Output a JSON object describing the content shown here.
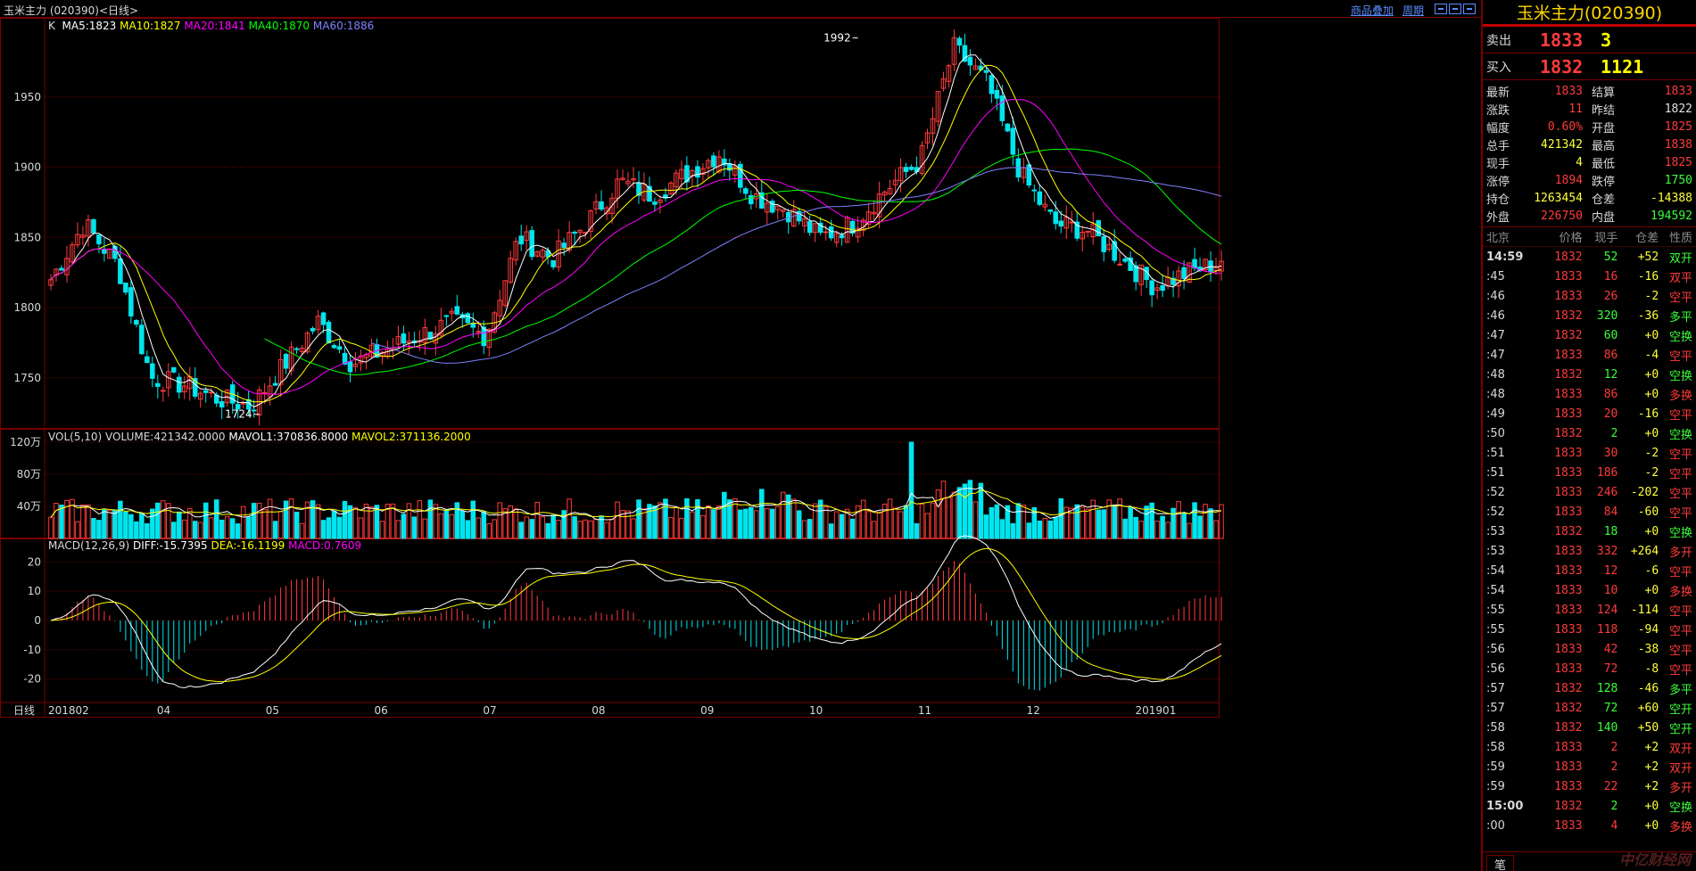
{
  "window": {
    "title": "玉米主力 (020390)<日线>",
    "link_overlay": "商品叠加",
    "link_period": "周期"
  },
  "main_panel": {
    "indicator_prefix": "K",
    "ma5": "MA5:1823",
    "ma10": "MA10:1827",
    "ma20": "MA20:1841",
    "ma40": "MA40:1870",
    "ma60": "MA60:1886",
    "high_label": "1992",
    "low_label": "1724",
    "y_ticks": [
      "1950",
      "1900",
      "1850",
      "1800",
      "1750"
    ]
  },
  "volume_panel": {
    "label_name": "VOL(5,10)",
    "label_volume": "VOLUME:421342.0000",
    "label_mavol1": "MAVOL1:370836.8000",
    "label_mavol2": "MAVOL2:371136.2000",
    "y_ticks": [
      "120万",
      "80万",
      "40万"
    ]
  },
  "macd_panel": {
    "label_name": "MACD(12,26,9)",
    "label_diff": "DIFF:-15.7395",
    "label_dea": "DEA:-16.1199",
    "label_macd": "MACD:0.7609",
    "y_ticks": [
      "20",
      "10",
      "0",
      "-10",
      "-20"
    ]
  },
  "x_axis": {
    "period_label": "日线",
    "labels": [
      "201802",
      "04",
      "05",
      "06",
      "07",
      "08",
      "09",
      "10",
      "11",
      "12",
      "201901"
    ]
  },
  "colors": {
    "up": "#ff3b3b",
    "down": "#00e5ee",
    "ma5": "#ffffff",
    "ma10": "#ffff00",
    "ma20": "#ff00ff",
    "ma40": "#00ff00",
    "ma60": "#8080ff",
    "grid": "#7a0000"
  },
  "quote": {
    "name": "玉米主力(020390)",
    "ask_label": "卖出",
    "ask_price": "1833",
    "ask_vol": "3",
    "bid_label": "买入",
    "bid_price": "1832",
    "bid_vol": "1121",
    "rows": [
      {
        "k": "最新",
        "v": "1833",
        "vc": "red",
        "k2": "结算",
        "v2": "1833",
        "v2c": "red"
      },
      {
        "k": "涨跌",
        "v": "11",
        "vc": "red",
        "k2": "昨结",
        "v2": "1822",
        "v2c": "white"
      },
      {
        "k": "幅度",
        "v": "0.60%",
        "vc": "red",
        "k2": "开盘",
        "v2": "1825",
        "v2c": "red"
      },
      {
        "k": "总手",
        "v": "421342",
        "vc": "yellow",
        "k2": "最高",
        "v2": "1838",
        "v2c": "red"
      },
      {
        "k": "现手",
        "v": "4",
        "vc": "yellow",
        "k2": "最低",
        "v2": "1825",
        "v2c": "red"
      },
      {
        "k": "涨停",
        "v": "1894",
        "vc": "red",
        "k2": "跌停",
        "v2": "1750",
        "v2c": "green"
      },
      {
        "k": "持仓",
        "v": "1263454",
        "vc": "yellow",
        "k2": "仓差",
        "v2": "-14388",
        "v2c": "yellow"
      },
      {
        "k": "外盘",
        "v": "226750",
        "vc": "red",
        "k2": "内盘",
        "v2": "194592",
        "v2c": "green"
      }
    ]
  },
  "ticks": {
    "headers": [
      "北京",
      "价格",
      "现手",
      "仓差",
      "性质"
    ],
    "rows": [
      {
        "t": "14:59",
        "p": "1832",
        "pc": "red",
        "v": "52",
        "vc": "green",
        "o": "+52",
        "oc": "yellow",
        "n": "双开",
        "nc": "green",
        "bold": true
      },
      {
        "t": ":45",
        "p": "1833",
        "pc": "red",
        "v": "16",
        "vc": "red",
        "o": "-16",
        "oc": "yellow",
        "n": "双平",
        "nc": "red"
      },
      {
        "t": ":46",
        "p": "1833",
        "pc": "red",
        "v": "26",
        "vc": "red",
        "o": "-2",
        "oc": "yellow",
        "n": "空平",
        "nc": "red"
      },
      {
        "t": ":46",
        "p": "1832",
        "pc": "red",
        "v": "320",
        "vc": "green",
        "o": "-36",
        "oc": "yellow",
        "n": "多平",
        "nc": "green"
      },
      {
        "t": ":47",
        "p": "1832",
        "pc": "red",
        "v": "60",
        "vc": "green",
        "o": "+0",
        "oc": "yellow",
        "n": "空换",
        "nc": "green"
      },
      {
        "t": ":47",
        "p": "1833",
        "pc": "red",
        "v": "86",
        "vc": "red",
        "o": "-4",
        "oc": "yellow",
        "n": "空平",
        "nc": "red"
      },
      {
        "t": ":48",
        "p": "1832",
        "pc": "red",
        "v": "12",
        "vc": "green",
        "o": "+0",
        "oc": "yellow",
        "n": "空换",
        "nc": "green"
      },
      {
        "t": ":48",
        "p": "1833",
        "pc": "red",
        "v": "86",
        "vc": "red",
        "o": "+0",
        "oc": "yellow",
        "n": "多换",
        "nc": "red"
      },
      {
        "t": ":49",
        "p": "1833",
        "pc": "red",
        "v": "20",
        "vc": "red",
        "o": "-16",
        "oc": "yellow",
        "n": "空平",
        "nc": "red"
      },
      {
        "t": ":50",
        "p": "1832",
        "pc": "red",
        "v": "2",
        "vc": "green",
        "o": "+0",
        "oc": "yellow",
        "n": "空换",
        "nc": "green"
      },
      {
        "t": ":51",
        "p": "1833",
        "pc": "red",
        "v": "30",
        "vc": "red",
        "o": "-2",
        "oc": "yellow",
        "n": "空平",
        "nc": "red"
      },
      {
        "t": ":51",
        "p": "1833",
        "pc": "red",
        "v": "186",
        "vc": "red",
        "o": "-2",
        "oc": "yellow",
        "n": "空平",
        "nc": "red"
      },
      {
        "t": ":52",
        "p": "1833",
        "pc": "red",
        "v": "246",
        "vc": "red",
        "o": "-202",
        "oc": "yellow",
        "n": "空平",
        "nc": "red"
      },
      {
        "t": ":52",
        "p": "1833",
        "pc": "red",
        "v": "84",
        "vc": "red",
        "o": "-60",
        "oc": "yellow",
        "n": "空平",
        "nc": "red"
      },
      {
        "t": ":53",
        "p": "1832",
        "pc": "red",
        "v": "18",
        "vc": "green",
        "o": "+0",
        "oc": "yellow",
        "n": "空换",
        "nc": "green"
      },
      {
        "t": ":53",
        "p": "1833",
        "pc": "red",
        "v": "332",
        "vc": "red",
        "o": "+264",
        "oc": "yellow",
        "n": "多开",
        "nc": "red"
      },
      {
        "t": ":54",
        "p": "1833",
        "pc": "red",
        "v": "12",
        "vc": "red",
        "o": "-6",
        "oc": "yellow",
        "n": "空平",
        "nc": "red"
      },
      {
        "t": ":54",
        "p": "1833",
        "pc": "red",
        "v": "10",
        "vc": "red",
        "o": "+0",
        "oc": "yellow",
        "n": "多换",
        "nc": "red"
      },
      {
        "t": ":55",
        "p": "1833",
        "pc": "red",
        "v": "124",
        "vc": "red",
        "o": "-114",
        "oc": "yellow",
        "n": "空平",
        "nc": "red"
      },
      {
        "t": ":55",
        "p": "1833",
        "pc": "red",
        "v": "118",
        "vc": "red",
        "o": "-94",
        "oc": "yellow",
        "n": "空平",
        "nc": "red"
      },
      {
        "t": ":56",
        "p": "1833",
        "pc": "red",
        "v": "42",
        "vc": "red",
        "o": "-38",
        "oc": "yellow",
        "n": "空平",
        "nc": "red"
      },
      {
        "t": ":56",
        "p": "1833",
        "pc": "red",
        "v": "72",
        "vc": "red",
        "o": "-8",
        "oc": "yellow",
        "n": "空平",
        "nc": "red"
      },
      {
        "t": ":57",
        "p": "1832",
        "pc": "red",
        "v": "128",
        "vc": "green",
        "o": "-46",
        "oc": "yellow",
        "n": "多平",
        "nc": "green"
      },
      {
        "t": ":57",
        "p": "1832",
        "pc": "red",
        "v": "72",
        "vc": "green",
        "o": "+60",
        "oc": "yellow",
        "n": "空开",
        "nc": "green"
      },
      {
        "t": ":58",
        "p": "1832",
        "pc": "red",
        "v": "140",
        "vc": "green",
        "o": "+50",
        "oc": "yellow",
        "n": "空开",
        "nc": "green"
      },
      {
        "t": ":58",
        "p": "1833",
        "pc": "red",
        "v": "2",
        "vc": "red",
        "o": "+2",
        "oc": "yellow",
        "n": "双开",
        "nc": "red"
      },
      {
        "t": ":59",
        "p": "1833",
        "pc": "red",
        "v": "2",
        "vc": "red",
        "o": "+2",
        "oc": "yellow",
        "n": "双开",
        "nc": "red"
      },
      {
        "t": ":59",
        "p": "1833",
        "pc": "red",
        "v": "22",
        "vc": "red",
        "o": "+2",
        "oc": "yellow",
        "n": "多开",
        "nc": "red"
      },
      {
        "t": "15:00",
        "p": "1832",
        "pc": "red",
        "v": "2",
        "vc": "green",
        "o": "+0",
        "oc": "yellow",
        "n": "空换",
        "nc": "green",
        "bold": true
      },
      {
        "t": ":00",
        "p": "1833",
        "pc": "red",
        "v": "4",
        "vc": "red",
        "o": "+0",
        "oc": "yellow",
        "n": "多换",
        "nc": "red"
      }
    ],
    "footer_tab": "笔",
    "watermark": "中亿财经网"
  },
  "chart_data": [
    {
      "type": "candlestick",
      "title": "玉米主力 (020390)<日线>",
      "ylim": [
        1720,
        2000
      ],
      "x": [
        "201802",
        "04",
        "05",
        "06",
        "07",
        "08",
        "09",
        "10",
        "11",
        "12",
        "201901"
      ],
      "annotations": [
        {
          "label": "1992",
          "value": 1992
        },
        {
          "label": "1724",
          "value": 1724
        }
      ],
      "close_anchors": [
        1820,
        1860,
        1830,
        1750,
        1745,
        1735,
        1730,
        1760,
        1790,
        1760,
        1770,
        1780,
        1790,
        1780,
        1850,
        1835,
        1860,
        1890,
        1880,
        1895,
        1910,
        1880,
        1870,
        1850,
        1860,
        1885,
        1905,
        1985,
        1960,
        1895,
        1860,
        1855,
        1835,
        1815,
        1825,
        1833
      ],
      "series": [
        {
          "name": "MA5",
          "values": [
            1823
          ]
        },
        {
          "name": "MA10",
          "values": [
            1827
          ]
        },
        {
          "name": "MA20",
          "values": [
            1841
          ]
        },
        {
          "name": "MA40",
          "values": [
            1870
          ]
        },
        {
          "name": "MA60",
          "values": [
            1886
          ]
        }
      ]
    },
    {
      "type": "bar",
      "title": "VOL(5,10)",
      "ylim": [
        0,
        1300000
      ],
      "series": [
        {
          "name": "VOLUME",
          "values": [
            421342
          ]
        },
        {
          "name": "MAVOL1",
          "values": [
            370836.8
          ]
        },
        {
          "name": "MAVOL2",
          "values": [
            371136.2
          ]
        }
      ]
    },
    {
      "type": "bar",
      "title": "MACD(12,26,9)",
      "ylim": [
        -25,
        25
      ],
      "series": [
        {
          "name": "DIFF",
          "values": [
            -15.7395
          ]
        },
        {
          "name": "DEA",
          "values": [
            -16.1199
          ]
        },
        {
          "name": "MACD",
          "values": [
            0.7609
          ]
        }
      ]
    }
  ]
}
